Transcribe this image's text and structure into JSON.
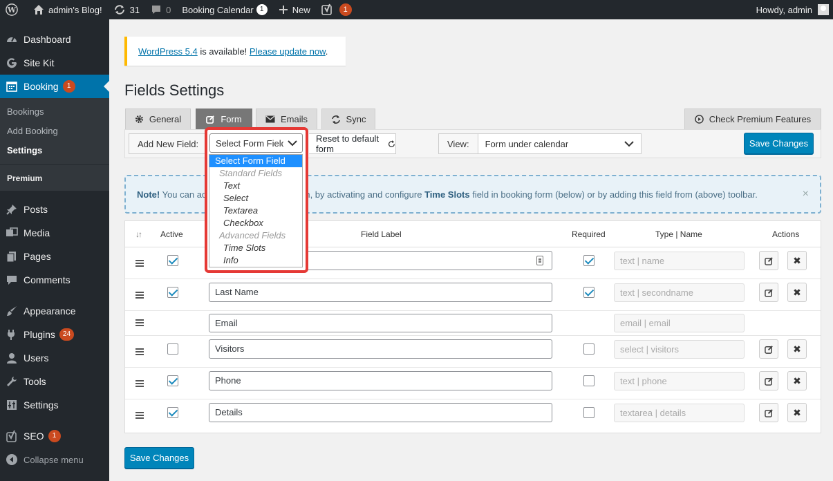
{
  "admin_bar": {
    "site_name": "admin's Blog!",
    "updates_count": "31",
    "comments_count": "0",
    "booking_calendar": "Booking Calendar",
    "booking_calendar_badge": "1",
    "new_label": "New",
    "yoast_badge": "1",
    "howdy": "Howdy, admin"
  },
  "sidebar": {
    "dashboard": "Dashboard",
    "site_kit": "Site Kit",
    "booking": "Booking",
    "booking_badge": "1",
    "sub_bookings": "Bookings",
    "sub_add_booking": "Add Booking",
    "sub_settings": "Settings",
    "sub_premium": "Premium",
    "posts": "Posts",
    "media": "Media",
    "pages": "Pages",
    "comments": "Comments",
    "appearance": "Appearance",
    "plugins": "Plugins",
    "plugins_badge": "24",
    "users": "Users",
    "tools": "Tools",
    "settings": "Settings",
    "seo": "SEO",
    "seo_badge": "1",
    "collapse": "Collapse menu"
  },
  "notice": {
    "wp_link": "WordPress 5.4",
    "middle": " is available! ",
    "update_link": "Please update now",
    "end": "."
  },
  "page_title": "Fields Settings",
  "tabs": {
    "general": "General",
    "form": "Form",
    "emails": "Emails",
    "sync": "Sync",
    "premium": "Check Premium Features"
  },
  "toolbar": {
    "add_new_field_label": "Add New Field:",
    "select_value": "Select Form Field",
    "reset_label": "Reset to default form",
    "view_label": "View:",
    "view_value": "Form under calendar",
    "save_label": "Save Changes"
  },
  "dropdown": {
    "options": [
      "Select Form Field",
      "Standard Fields",
      "Text",
      "Select",
      "Textarea",
      "Checkbox",
      "Advanced Fields",
      "Time Slots",
      "Info"
    ]
  },
  "note": {
    "prefix": "Note!",
    "text_a": " You can ad",
    "text_b": "orm, by activating and configure ",
    "time_slots": "Time Slots",
    "text_c": " field in booking form (below) or by adding this field from (above) toolbar.",
    "close": "×"
  },
  "table": {
    "headers": {
      "sort": "↓↑",
      "active": "Active",
      "label": "Field Label",
      "required": "Required",
      "type_name": "Type | Name",
      "actions": "Actions"
    },
    "rows": [
      {
        "label": "",
        "active": true,
        "required": true,
        "type": "text | name"
      },
      {
        "label": "Last Name",
        "active": true,
        "required": true,
        "type": "text | secondname"
      },
      {
        "label": "Email",
        "active": null,
        "required": null,
        "type": "email | email"
      },
      {
        "label": "Visitors",
        "active": false,
        "required": false,
        "type": "select | visitors"
      },
      {
        "label": "Phone",
        "active": true,
        "required": false,
        "type": "text | phone"
      },
      {
        "label": "Details",
        "active": true,
        "required": false,
        "type": "textarea | details"
      }
    ],
    "delete_glyph": "✖"
  },
  "bottom_save": "Save Changes"
}
